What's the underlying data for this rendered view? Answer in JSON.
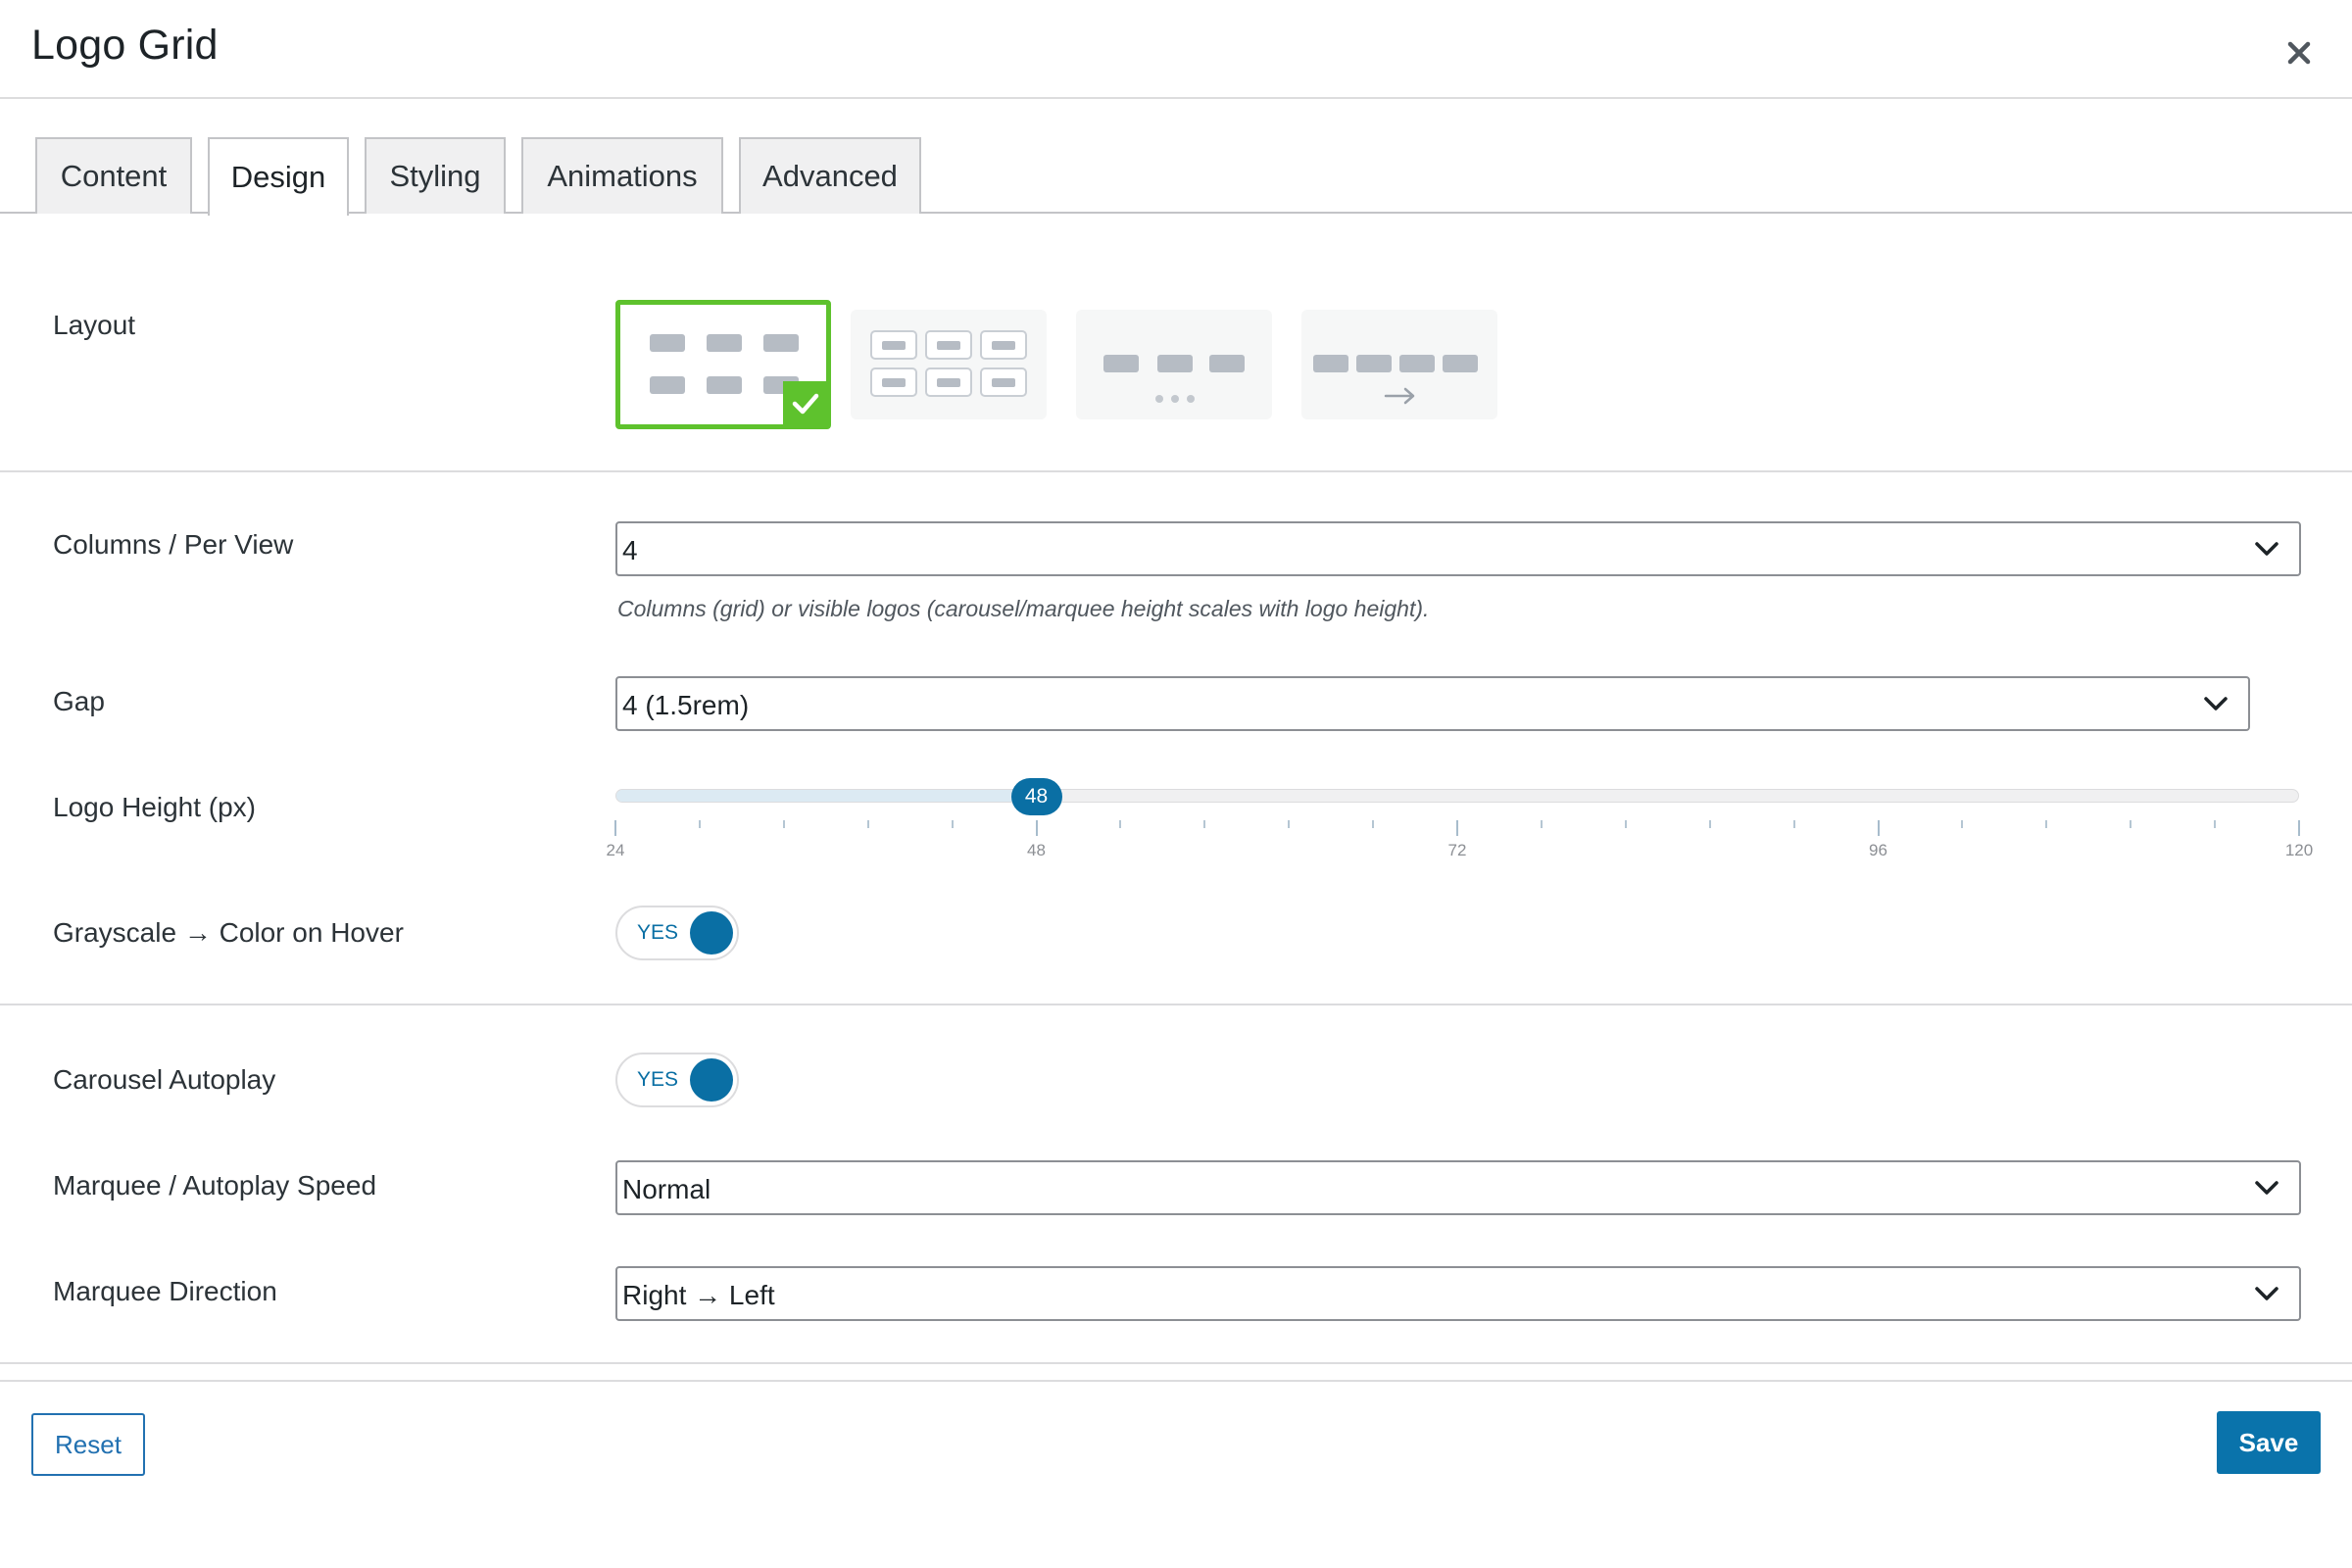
{
  "modal": {
    "title": "Logo Grid"
  },
  "icons": {
    "close": "close-icon",
    "check": "check-icon",
    "chevron": "chevron-down-icon",
    "arrow": "arrow-right-icon"
  },
  "tabs": [
    {
      "label": "Content",
      "active": false
    },
    {
      "label": "Design",
      "active": true
    },
    {
      "label": "Styling",
      "active": false
    },
    {
      "label": "Animations",
      "active": false
    },
    {
      "label": "Advanced",
      "active": false
    }
  ],
  "fields": {
    "layout": {
      "label": "Layout",
      "options": [
        "grid",
        "cards",
        "carousel",
        "marquee"
      ],
      "selected": "grid"
    },
    "columns": {
      "label": "Columns / Per View",
      "value": "4",
      "help": "Columns (grid) or visible logos (carousel/marquee height scales with logo height)."
    },
    "gap": {
      "label": "Gap",
      "value": "4 (1.5rem)"
    },
    "logo_height": {
      "label": "Logo Height (px)",
      "value": 48,
      "value_text": "48",
      "min": 24,
      "max": 120,
      "tick_labels": [
        "24",
        "48",
        "72",
        "96",
        "120"
      ]
    },
    "grayscale": {
      "label": "Grayscale → Color on Hover",
      "toggle_text": "YES",
      "on": true
    },
    "autoplay": {
      "label": "Carousel Autoplay",
      "toggle_text": "YES",
      "on": true
    },
    "speed": {
      "label": "Marquee / Autoplay Speed",
      "value": "Normal"
    },
    "direction": {
      "label": "Marquee Direction",
      "value": "Right → Left"
    }
  },
  "footer": {
    "reset_label": "Reset",
    "save_label": "Save"
  },
  "colors": {
    "accent": "#0a6fa4",
    "selected_border": "#5ec22d",
    "primary_button": "#0a73ab",
    "secondary_button_text": "#2271b1"
  }
}
